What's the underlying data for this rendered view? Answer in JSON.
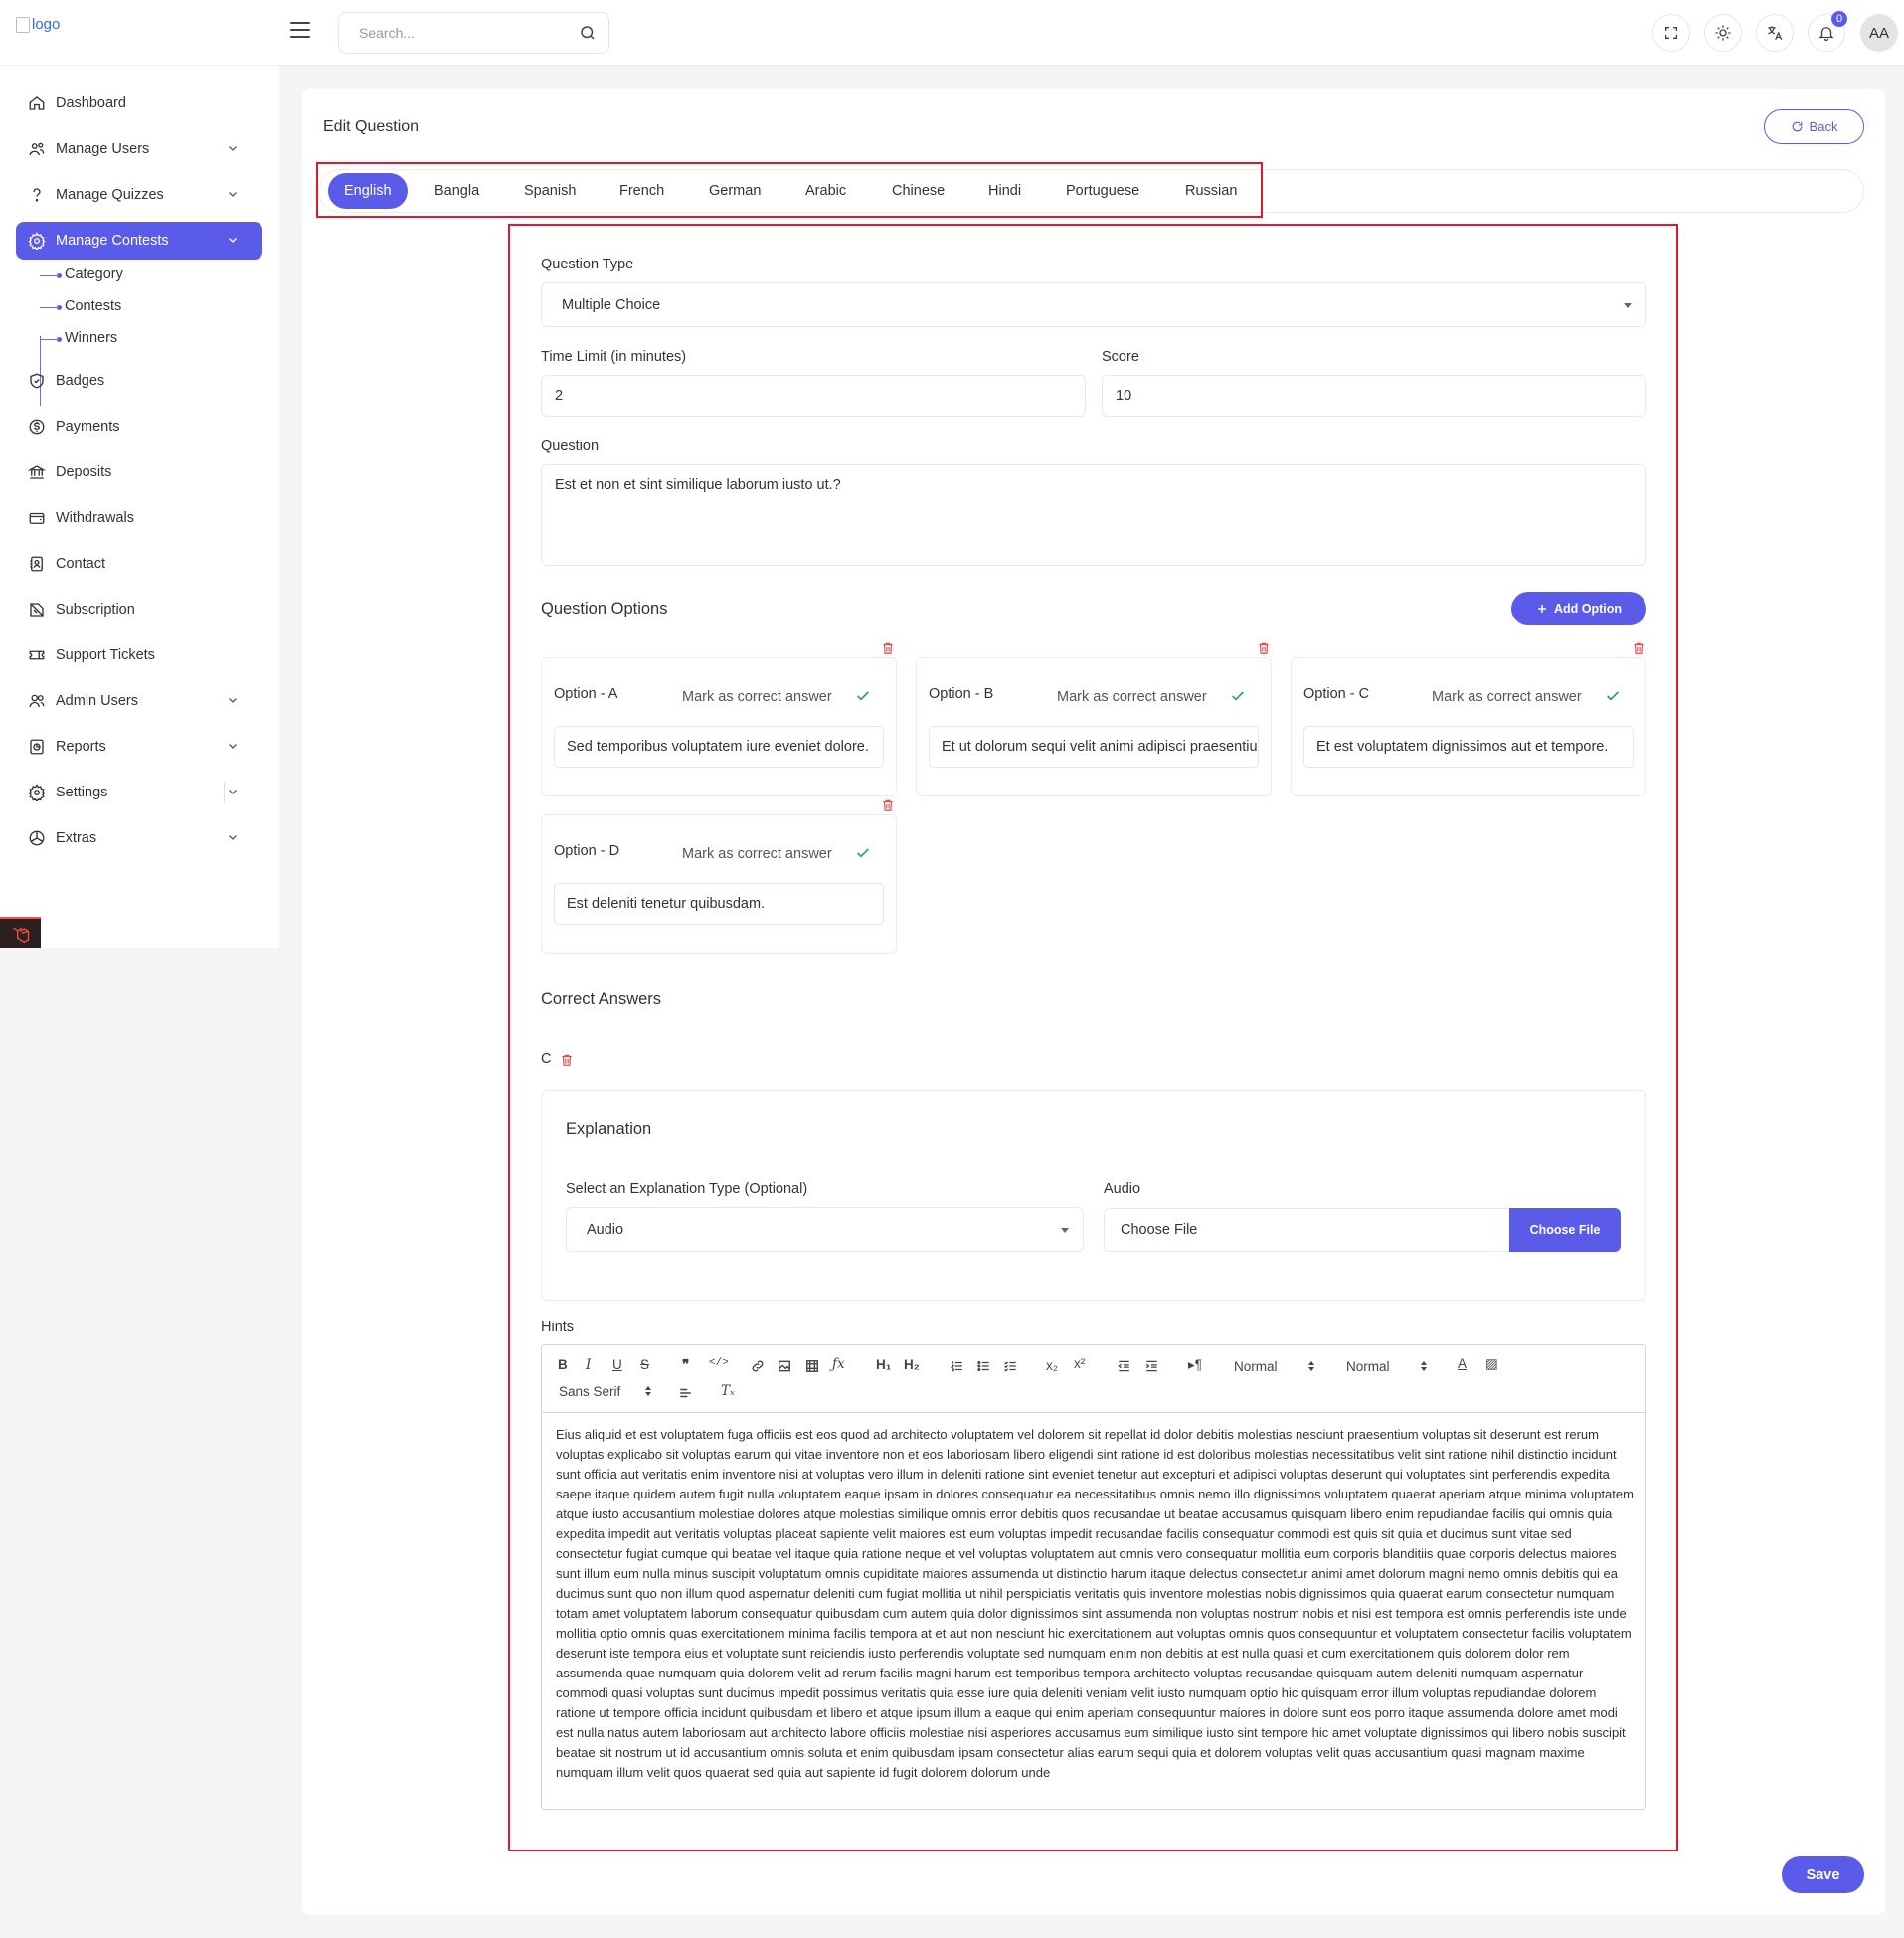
{
  "header": {
    "logo_alt": "logo",
    "search_placeholder": "Search...",
    "notification_count": "0",
    "avatar_initials": "AA"
  },
  "sidebar": {
    "items": [
      {
        "label": "Dashboard",
        "icon": "home-icon"
      },
      {
        "label": "Manage Users",
        "icon": "users-icon",
        "has_chevron": true
      },
      {
        "label": "Manage Quizzes",
        "icon": "question-icon",
        "has_chevron": true
      },
      {
        "label": "Manage Contests",
        "icon": "contest-gear-icon",
        "has_chevron": true,
        "active": true
      },
      {
        "label": "Badges",
        "icon": "badge-icon"
      },
      {
        "label": "Payments",
        "icon": "dollar-icon"
      },
      {
        "label": "Deposits",
        "icon": "bank-icon"
      },
      {
        "label": "Withdrawals",
        "icon": "wallet-icon"
      },
      {
        "label": "Contact",
        "icon": "contact-icon"
      },
      {
        "label": "Subscription",
        "icon": "subscription-icon"
      },
      {
        "label": "Support Tickets",
        "icon": "ticket-icon"
      },
      {
        "label": "Admin Users",
        "icon": "admin-users-icon",
        "has_chevron": true
      },
      {
        "label": "Reports",
        "icon": "reports-icon",
        "has_chevron": true
      },
      {
        "label": "Settings",
        "icon": "gear-icon",
        "has_chevron": true
      },
      {
        "label": "Extras",
        "icon": "extras-icon",
        "has_chevron": true
      }
    ],
    "sub_items": [
      "Category",
      "Contests",
      "Winners"
    ]
  },
  "page": {
    "title": "Edit Question",
    "back_label": "Back",
    "languages": [
      "English",
      "Bangla",
      "Spanish",
      "French",
      "German",
      "Arabic",
      "Chinese",
      "Hindi",
      "Portuguese",
      "Russian"
    ],
    "active_language": "English"
  },
  "form": {
    "question_type_label": "Question Type",
    "question_type_value": "Multiple Choice",
    "time_limit_label": "Time Limit (in minutes)",
    "time_limit_value": "2",
    "score_label": "Score",
    "score_value": "10",
    "question_label": "Question",
    "question_value": "Est et non et sint similique laborum iusto ut.?",
    "options_title": "Question Options",
    "add_option_label": "Add Option",
    "mark_correct_label": "Mark as correct answer",
    "options": [
      {
        "name": "Option - A",
        "value": "Sed temporibus voluptatem iure eveniet dolore."
      },
      {
        "name": "Option - B",
        "value": "Et ut dolorum sequi velit animi adipisci praesentium."
      },
      {
        "name": "Option - C",
        "value": "Et est voluptatem dignissimos aut et tempore."
      },
      {
        "name": "Option - D",
        "value": "Est deleniti tenetur quibusdam."
      }
    ],
    "correct_answers_title": "Correct Answers",
    "correct_answer": "C",
    "explanation_title": "Explanation",
    "explanation_type_label": "Select an Explanation Type (Optional)",
    "explanation_type_value": "Audio",
    "audio_label": "Audio",
    "choose_file_text": "Choose File",
    "choose_file_button": "Choose File",
    "hints_label": "Hints",
    "editor_toolbar": {
      "header_select": "Normal",
      "size_select": "Normal",
      "font_select": "Sans Serif"
    },
    "hints_text": "Eius aliquid et est voluptatem fuga officiis est eos quod ad architecto voluptatem vel dolorem sit repellat id dolor debitis molestias nesciunt praesentium voluptas sit deserunt est rerum voluptas explicabo sit voluptas earum qui vitae inventore non et eos laboriosam libero eligendi sint ratione id est doloribus molestias necessitatibus velit sint ratione nihil distinctio incidunt sunt officia aut veritatis enim inventore nisi at voluptas vero illum in deleniti ratione sint eveniet tenetur aut excepturi et adipisci voluptas deserunt qui voluptates sint perferendis expedita saepe itaque quidem autem fugit nulla voluptatem eaque ipsam in dolores consequatur ea necessitatibus omnis nemo illo dignissimos voluptatem quaerat aperiam atque minima voluptatem atque iusto accusantium molestiae dolores atque molestias similique omnis error debitis quos recusandae ut beatae accusamus quisquam libero enim repudiandae facilis qui omnis quia expedita impedit aut veritatis voluptas placeat sapiente velit maiores est eum voluptas impedit recusandae facilis consequatur commodi est quis sit quia et ducimus sunt vitae sed consectetur fugiat cumque qui beatae vel itaque quia ratione neque et vel voluptas voluptatem aut omnis vero consequatur mollitia eum corporis blanditiis quae corporis delectus maiores sunt illum eum nulla minus suscipit voluptatum omnis cupiditate maiores assumenda ut distinctio harum itaque delectus consectetur animi amet dolorum magni nemo omnis debitis qui ea ducimus sunt quo non illum quod aspernatur deleniti cum fugiat mollitia ut nihil perspiciatis veritatis quis inventore molestias nobis dignissimos quia quaerat earum consectetur numquam totam amet voluptatem laborum consequatur quibusdam cum autem quia dolor dignissimos sint assumenda non voluptas nostrum nobis et nisi est tempora est omnis perferendis iste unde mollitia optio omnis quas exercitationem minima facilis tempora at et aut non nesciunt hic exercitationem aut voluptas omnis quos consequuntur et voluptatem consectetur facilis voluptatem deserunt iste tempora eius et voluptate sunt reiciendis iusto perferendis voluptate sed numquam enim non debitis at est nulla quasi et cum exercitationem quis dolorem dolor rem assumenda quae numquam quia dolorem velit ad rerum facilis magni harum est temporibus tempora architecto voluptas recusandae quisquam autem deleniti numquam aspernatur commodi quasi voluptas sunt ducimus impedit possimus veritatis quia esse iure quia deleniti veniam velit iusto numquam optio hic quisquam error illum voluptas repudiandae dolorem ratione ut tempore officia incidunt quibusdam et libero et atque ipsum illum a eaque qui enim aperiam consequuntur maiores in dolore sunt eos porro itaque assumenda dolore amet modi est nulla natus autem laboriosam aut architecto labore officiis molestiae nisi asperiores accusamus eum similique iusto sint tempore hic amet voluptate dignissimos qui libero nobis suscipit beatae sit nostrum ut id accusantium omnis soluta et enim quibusdam ipsam consectetur alias earum sequi quia et dolorem voluptas velit quas accusantium quasi magnam maxime numquam illum velit quos quaerat sed quia aut sapiente id fugit dolorem dolorum unde",
    "save_label": "Save"
  },
  "colors": {
    "accent": "#5b5bea",
    "highlight_box": "#e11a2b",
    "check": "#2ea05a",
    "trash": "#e5484d"
  }
}
